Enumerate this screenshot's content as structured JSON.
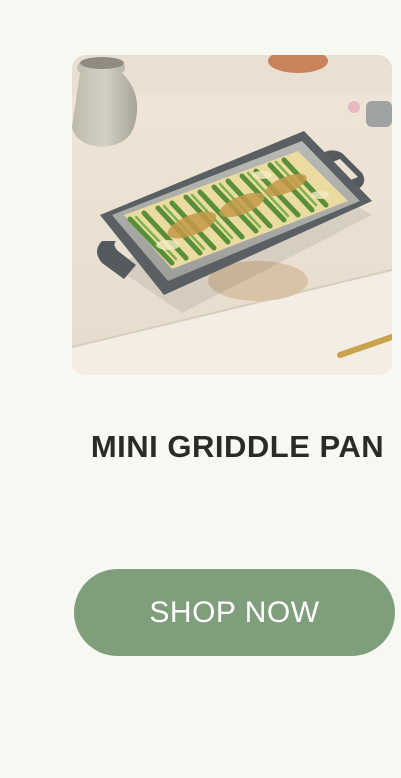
{
  "product": {
    "image_subject": "mini-griddle-pan-with-asparagus",
    "name": "MINI GRIDDLE PAN"
  },
  "cta": {
    "label": "SHOP NOW"
  },
  "colors": {
    "background": "#f8f8f3",
    "button": "#7f9e7c",
    "button_text": "#ffffff",
    "title_text": "#2b2a28"
  }
}
